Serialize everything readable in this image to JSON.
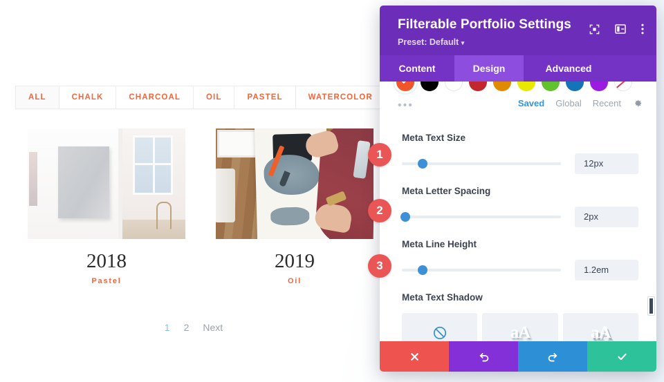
{
  "preview": {
    "filters": [
      {
        "label": "ALL",
        "active": true
      },
      {
        "label": "CHALK",
        "active": false
      },
      {
        "label": "CHARCOAL",
        "active": false
      },
      {
        "label": "OIL",
        "active": false
      },
      {
        "label": "PASTEL",
        "active": false
      },
      {
        "label": "WATERCOLOR",
        "active": false
      }
    ],
    "items": [
      {
        "title": "2018",
        "meta": "Pastel"
      },
      {
        "title": "2019",
        "meta": "Oil"
      }
    ],
    "pagination": [
      {
        "label": "1",
        "current": true
      },
      {
        "label": "2",
        "current": false
      },
      {
        "label": "Next",
        "current": false
      }
    ]
  },
  "modal": {
    "title": "Filterable Portfolio Settings",
    "preset": "Preset: Default",
    "preset_caret": "▾",
    "header_icons": [
      {
        "name": "focus-icon"
      },
      {
        "name": "layout-panel-icon"
      },
      {
        "name": "more-vertical-icon"
      }
    ],
    "tabs": [
      {
        "label": "Content",
        "active": false
      },
      {
        "label": "Design",
        "active": true
      },
      {
        "label": "Advanced",
        "active": false
      }
    ],
    "colors": {
      "swatches": [
        {
          "hex": "#f0562a",
          "selected": true
        },
        {
          "hex": "#000000",
          "selected": false
        },
        {
          "hex": "#ffffff",
          "selected": false
        },
        {
          "hex": "#c1272d",
          "selected": false
        },
        {
          "hex": "#e08a00",
          "selected": false
        },
        {
          "hex": "#e8e800",
          "selected": false
        },
        {
          "hex": "#62c22e",
          "selected": false
        },
        {
          "hex": "#1574b8",
          "selected": false
        },
        {
          "hex": "#9b1ce0",
          "selected": false
        },
        {
          "hex": "#ffffff",
          "selected": false,
          "striped": true
        }
      ],
      "more_label": "•••",
      "modes": [
        {
          "label": "Saved",
          "active": true
        },
        {
          "label": "Global",
          "active": false
        },
        {
          "label": "Recent",
          "active": false
        }
      ],
      "settings_icon": "gear-icon"
    },
    "fields": [
      {
        "label": "Meta Text Size",
        "value": "12px",
        "knob_percent": 13
      },
      {
        "label": "Meta Letter Spacing",
        "value": "2px",
        "knob_percent": 2
      },
      {
        "label": "Meta Line Height",
        "value": "1.2em",
        "knob_percent": 13
      }
    ],
    "text_shadow": {
      "label": "Meta Text Shadow",
      "options": [
        {
          "type": "none",
          "icon": "no-shadow-icon",
          "label": ""
        },
        {
          "type": "soft",
          "icon": "",
          "label": "aA"
        },
        {
          "type": "hard",
          "icon": "",
          "label": "aA"
        }
      ]
    },
    "footer": [
      {
        "name": "cancel",
        "icon": "close-icon"
      },
      {
        "name": "undo",
        "icon": "undo-icon"
      },
      {
        "name": "redo",
        "icon": "redo-icon"
      },
      {
        "name": "save",
        "icon": "check-icon"
      }
    ]
  },
  "annotations": [
    {
      "number": "1"
    },
    {
      "number": "2"
    },
    {
      "number": "3"
    }
  ]
}
